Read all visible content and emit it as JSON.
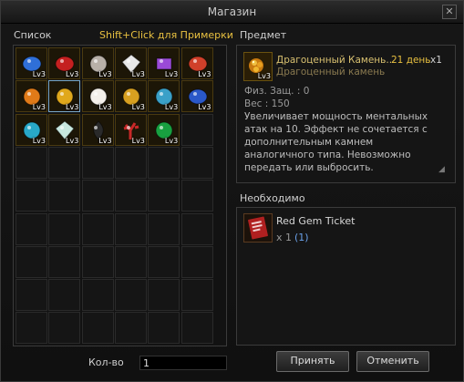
{
  "window": {
    "title": "Магазин"
  },
  "list": {
    "label": "Список",
    "hint": "Shift+Click для Примерки",
    "items": [
      {
        "name": "blue-gem-icon",
        "color": "#2f6fd8",
        "shape": "oval",
        "level": "Lv3"
      },
      {
        "name": "red-gem-icon",
        "color": "#c42020",
        "shape": "oval",
        "level": "Lv3"
      },
      {
        "name": "pearl-gem-icon",
        "color": "#b8b0a8",
        "shape": "round",
        "level": "Lv3"
      },
      {
        "name": "diamond-gem-icon",
        "color": "#e8e8e8",
        "shape": "diamond",
        "level": "Lv3"
      },
      {
        "name": "amethyst-gem-icon",
        "color": "#9a4ad8",
        "shape": "square",
        "level": "Lv3"
      },
      {
        "name": "red-orange-gem-icon",
        "color": "#d0402a",
        "shape": "oval",
        "level": "Lv3"
      },
      {
        "name": "orange-gem-icon",
        "color": "#e07a18",
        "shape": "round",
        "level": "Lv3"
      },
      {
        "name": "gold-cluster-gem-icon",
        "color": "#e0a81c",
        "shape": "round",
        "level": "Lv3"
      },
      {
        "name": "white-pearl-gem-icon",
        "color": "#f4f0ea",
        "shape": "round",
        "level": "Lv3"
      },
      {
        "name": "yellow-gem-icon",
        "color": "#d8a020",
        "shape": "round",
        "level": "Lv3"
      },
      {
        "name": "multicolor-gem-icon",
        "color": "#3aa0c8",
        "shape": "round",
        "level": "Lv3"
      },
      {
        "name": "sapphire-gem-icon",
        "color": "#2a58c8",
        "shape": "oval",
        "level": "Lv3"
      },
      {
        "name": "aquamarine-gem-icon",
        "color": "#28a8c8",
        "shape": "round",
        "level": "Lv3"
      },
      {
        "name": "crystal-gem-icon",
        "color": "#c8e8e0",
        "shape": "diamond",
        "level": "Lv3"
      },
      {
        "name": "black-gem-icon",
        "color": "#2a2a2a",
        "shape": "drop",
        "level": "Lv3"
      },
      {
        "name": "coral-gem-icon",
        "color": "#c82828",
        "shape": "coral",
        "level": "Lv3"
      },
      {
        "name": "emerald-gem-icon",
        "color": "#18a040",
        "shape": "round",
        "level": "Lv3"
      }
    ]
  },
  "item": {
    "label": "Предмет",
    "name": "Драгоценный Камень..",
    "duration": "21 день",
    "count": "x1",
    "type": "Драгоценный камень",
    "def": "Физ. Защ. : 0",
    "weight": "Вес : 150",
    "description": [
      "Увеличивает мощность ментальных",
      "атак на 10. Эффект не сочетается с",
      "дополнительным камнем",
      "аналогичного типа. Невозможно",
      "передать или выбросить."
    ],
    "icon_level": "Lv3"
  },
  "required": {
    "label": "Необходимо",
    "name": "Red Gem Ticket",
    "qty": "x 1",
    "qty_have": "(1)"
  },
  "footer": {
    "qty_label": "Кол-во",
    "qty_value": "1",
    "accept": "Принять",
    "cancel": "Отменить"
  },
  "colors": {
    "hint": "#e8c040",
    "accent": "#d8c070",
    "blue": "#6aa0e8"
  }
}
